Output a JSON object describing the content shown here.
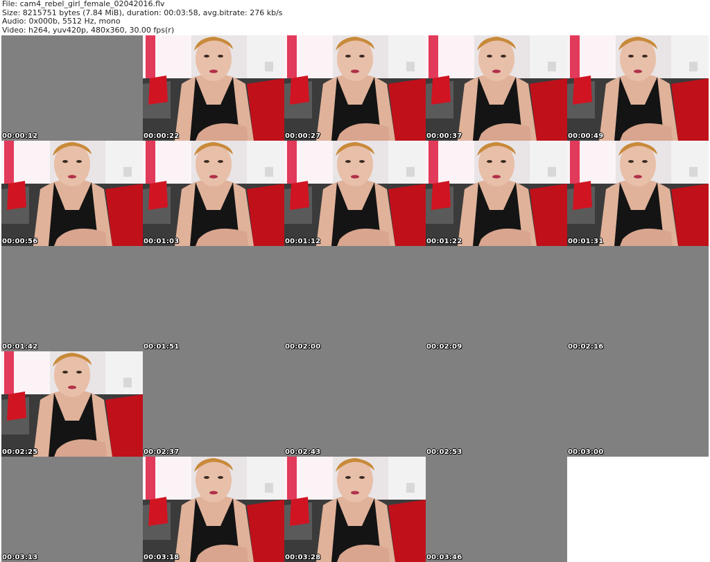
{
  "header": {
    "file_line": "File: cam4_rebel_girl_female_02042016.flv",
    "size_line": "Size: 8215751 bytes (7.84 MiB), duration: 00:03:58, avg.bitrate: 276 kb/s",
    "audio_line": "Audio: 0x000b, 5512 Hz, mono",
    "video_line": "Video: h264, yuv420p, 480x360, 30.00 fps(r)"
  },
  "tiles": [
    {
      "timestamp": "00:00:12",
      "content": "blank"
    },
    {
      "timestamp": "00:00:22",
      "content": "webcam-frame"
    },
    {
      "timestamp": "00:00:27",
      "content": "webcam-frame"
    },
    {
      "timestamp": "00:00:37",
      "content": "webcam-frame"
    },
    {
      "timestamp": "00:00:49",
      "content": "webcam-frame"
    },
    {
      "timestamp": "00:00:56",
      "content": "webcam-frame"
    },
    {
      "timestamp": "00:01:03",
      "content": "webcam-frame"
    },
    {
      "timestamp": "00:01:12",
      "content": "webcam-frame"
    },
    {
      "timestamp": "00:01:22",
      "content": "webcam-frame"
    },
    {
      "timestamp": "00:01:31",
      "content": "webcam-frame"
    },
    {
      "timestamp": "00:01:42",
      "content": "blank"
    },
    {
      "timestamp": "00:01:51",
      "content": "blank"
    },
    {
      "timestamp": "00:02:00",
      "content": "blank"
    },
    {
      "timestamp": "00:02:09",
      "content": "blank"
    },
    {
      "timestamp": "00:02:16",
      "content": "blank"
    },
    {
      "timestamp": "00:02:25",
      "content": "webcam-frame"
    },
    {
      "timestamp": "00:02:37",
      "content": "blank"
    },
    {
      "timestamp": "00:02:43",
      "content": "blank"
    },
    {
      "timestamp": "00:02:53",
      "content": "blank"
    },
    {
      "timestamp": "00:03:00",
      "content": "blank"
    },
    {
      "timestamp": "00:03:13",
      "content": "blank"
    },
    {
      "timestamp": "00:03:18",
      "content": "webcam-frame"
    },
    {
      "timestamp": "00:03:28",
      "content": "webcam-frame"
    },
    {
      "timestamp": "00:03:46",
      "content": "blank"
    },
    {
      "timestamp": "",
      "content": "empty"
    }
  ]
}
